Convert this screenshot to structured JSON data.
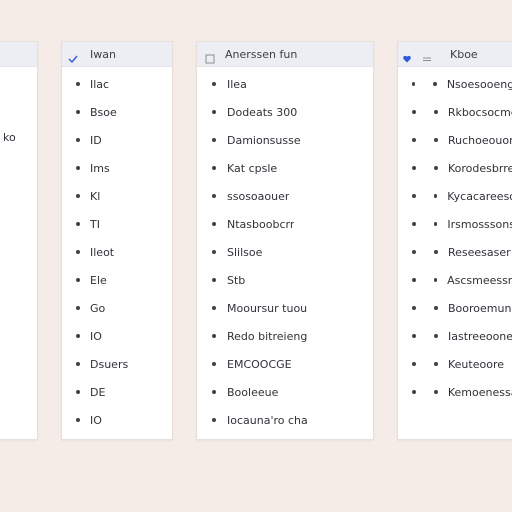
{
  "colors": {
    "background": "#f6ece7",
    "panel": "#ffffff",
    "header": "#eceef3",
    "accent": "#2f5ad8"
  },
  "panels": [
    {
      "id": "panel-1",
      "header": "",
      "header_icon": "",
      "items": [
        "",
        "",
        "ko",
        "",
        "",
        "",
        "",
        "",
        "",
        "",
        ""
      ]
    },
    {
      "id": "panel-2",
      "header": "Iwan",
      "header_icon": "checkmark-icon",
      "items": [
        "Ilac",
        "Bsoe",
        "ID",
        "Ims",
        "Kl",
        "TI",
        "Ileot",
        "Ele",
        "Go",
        "IO",
        "Dsuers",
        "DE",
        "IO"
      ]
    },
    {
      "id": "panel-3",
      "header": "Anerssen fun",
      "header_icon": "square-icon",
      "items": [
        "Ilea",
        "Dodeats 300",
        "Damionsusse",
        "Kat cpsle",
        "ssosoaouer",
        "Ntasboobcrr",
        "Slilsoe",
        "Stb",
        "Mooursur tuou",
        "Redo bitreieng",
        "EMCOOCGE",
        "Booleeue",
        "Iocauna'ro cha"
      ]
    },
    {
      "id": "panel-4",
      "header": "Kboe",
      "header_icon": "heart-icon",
      "items": [
        "Nsoesooengpe",
        "Rkbocsocme",
        "Ruchoeouon",
        "Korodesbrre",
        "Kycacareeson",
        "Irsmosssonse",
        "Reseesaser",
        "Ascsmeessme",
        "Booroemun",
        "Iastreeoone",
        "Keuteoore",
        "Kemoenessa"
      ]
    }
  ]
}
